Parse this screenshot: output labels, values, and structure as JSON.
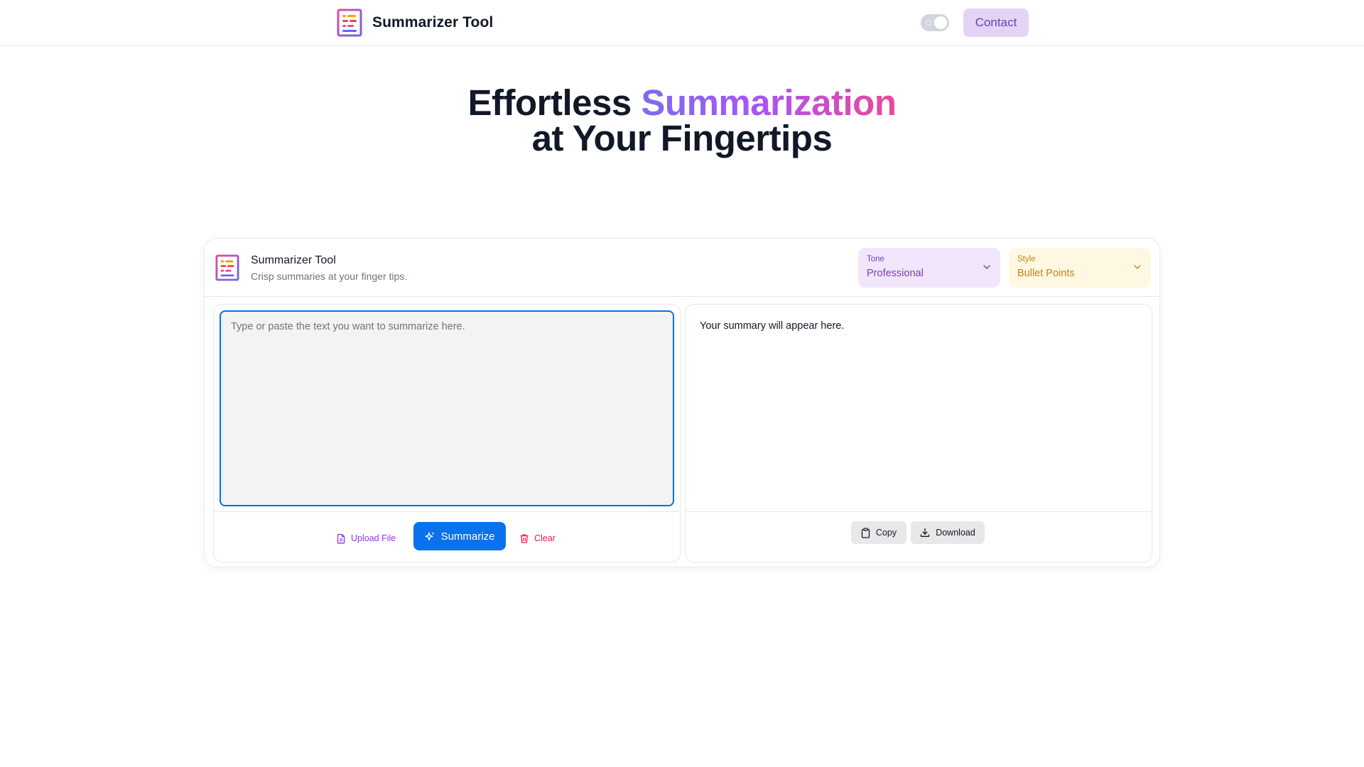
{
  "navbar": {
    "title": "Summarizer Tool",
    "contact_label": "Contact",
    "theme_toggle": "on"
  },
  "hero": {
    "line1_prefix": "Effortless ",
    "line1_highlight": "Summarization",
    "line2": "at Your Fingertips"
  },
  "card": {
    "title": "Summarizer Tool",
    "subtitle": "Crisp summaries at your finger tips.",
    "tone": {
      "label": "Tone",
      "value": "Professional"
    },
    "style": {
      "label": "Style",
      "value": "Bullet Points"
    }
  },
  "input": {
    "value": "",
    "placeholder": "Type or paste the text you want to summarize here."
  },
  "actions": {
    "upload_label": "Upload File",
    "summarize_label": "Summarize",
    "clear_label": "Clear"
  },
  "output": {
    "placeholder_text": "Your summary will appear here.",
    "copy_label": "Copy",
    "download_label": "Download"
  },
  "colors": {
    "primary_blue": "#0a72ee",
    "contact_bg": "#e4d3f7",
    "tone_bg": "#f1e6fb",
    "style_bg": "#fef8e2",
    "gradient": [
      "#7c6cf0",
      "#a855f7",
      "#ec4899"
    ]
  },
  "icons": [
    "app-logo-icon",
    "theme-toggle",
    "chevron-down-icon",
    "file-icon",
    "sparkles-icon",
    "trash-icon",
    "clipboard-icon",
    "download-icon"
  ]
}
